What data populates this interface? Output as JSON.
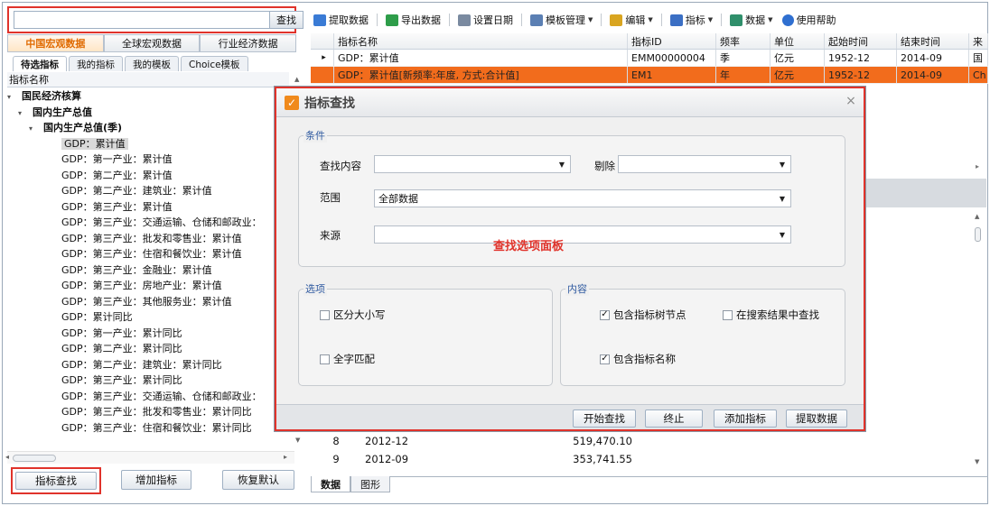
{
  "search": {
    "button": "查找",
    "value": ""
  },
  "category_tabs": [
    "中国宏观数据",
    "全球宏观数据",
    "行业经济数据"
  ],
  "sub_tabs": [
    "待选指标",
    "我的指标",
    "我的模板",
    "Choice模板"
  ],
  "tree": {
    "header": "指标名称",
    "items": [
      {
        "label": "国民经济核算",
        "level": 0,
        "bold": true,
        "toggle": "▾"
      },
      {
        "label": "国内生产总值",
        "level": 1,
        "bold": true,
        "toggle": "▾"
      },
      {
        "label": "国内生产总值(季)",
        "level": 2,
        "bold": true,
        "toggle": "▾"
      },
      {
        "label": "GDP：累计值",
        "level": 3,
        "selected": true
      },
      {
        "label": "GDP：第一产业：累计值",
        "level": 3
      },
      {
        "label": "GDP：第二产业：累计值",
        "level": 3
      },
      {
        "label": "GDP：第二产业：建筑业：累计值",
        "level": 3
      },
      {
        "label": "GDP：第三产业：累计值",
        "level": 3
      },
      {
        "label": "GDP：第三产业：交通运输、仓储和邮政业：",
        "level": 3
      },
      {
        "label": "GDP：第三产业：批发和零售业：累计值",
        "level": 3
      },
      {
        "label": "GDP：第三产业：住宿和餐饮业：累计值",
        "level": 3
      },
      {
        "label": "GDP：第三产业：金融业：累计值",
        "level": 3
      },
      {
        "label": "GDP：第三产业：房地产业：累计值",
        "level": 3
      },
      {
        "label": "GDP：第三产业：其他服务业：累计值",
        "level": 3
      },
      {
        "label": "GDP：累计同比",
        "level": 3
      },
      {
        "label": "GDP：第一产业：累计同比",
        "level": 3
      },
      {
        "label": "GDP：第二产业：累计同比",
        "level": 3
      },
      {
        "label": "GDP：第二产业：建筑业：累计同比",
        "level": 3
      },
      {
        "label": "GDP：第三产业：累计同比",
        "level": 3
      },
      {
        "label": "GDP：第三产业：交通运输、仓储和邮政业：",
        "level": 3
      },
      {
        "label": "GDP：第三产业：批发和零售业：累计同比",
        "level": 3
      },
      {
        "label": "GDP：第三产业：住宿和餐饮业：累计同比",
        "level": 3
      }
    ]
  },
  "left_buttons": [
    "指标查找",
    "增加指标",
    "恢复默认"
  ],
  "toolbar": [
    {
      "label": "提取数据",
      "icon": "extract-data-icon",
      "color": "#3a7bd5",
      "caret": false
    },
    {
      "label": "导出数据",
      "icon": "export-data-icon",
      "color": "#2e9d4a",
      "caret": false
    },
    {
      "label": "设置日期",
      "icon": "calendar-icon",
      "color": "#7a8aa0",
      "caret": false
    },
    {
      "label": "模板管理",
      "icon": "template-icon",
      "color": "#5b7fb3",
      "caret": true
    },
    {
      "label": "编辑",
      "icon": "edit-icon",
      "color": "#d9a520",
      "caret": true
    },
    {
      "label": "指标",
      "icon": "function-icon",
      "color": "#3b6fc4",
      "caret": true
    },
    {
      "label": "数据",
      "icon": "data-icon",
      "color": "#2f8f6b",
      "caret": true
    },
    {
      "label": "使用帮助",
      "icon": "help-icon",
      "color": "#2f6fd0",
      "caret": false
    }
  ],
  "grid": {
    "headers": [
      "",
      "指标名称",
      "指标ID",
      "频率",
      "单位",
      "起始时间",
      "结束时间",
      "来"
    ],
    "rows": [
      {
        "marker": "▸",
        "cells": [
          "GDP：累计值",
          "EMM00000004",
          "季",
          "亿元",
          "1952-12",
          "2014-09",
          "国"
        ],
        "highlight": false
      },
      {
        "marker": "",
        "cells": [
          "GDP：累计值[新频率:年度, 方式:合计值]",
          "EM1",
          "年",
          "亿元",
          "1952-12",
          "2014-09",
          "Ch"
        ],
        "highlight": true
      }
    ]
  },
  "data_rows": [
    {
      "index": "8",
      "date": "2012-12",
      "value": "519,470.10"
    },
    {
      "index": "9",
      "date": "2012-09",
      "value": "353,741.55"
    }
  ],
  "bottom_tabs": [
    "数据",
    "图形"
  ],
  "dialog": {
    "title": "指标查找",
    "conditions_label": "条件",
    "find_label": "查找内容",
    "find_value": "",
    "exclude_label": "剔除",
    "exclude_value": "",
    "scope_label": "范围",
    "scope_value": "全部数据",
    "source_label": "来源",
    "source_value": "",
    "annotation": "查找选项面板",
    "options_label": "选项",
    "opt_case": "区分大小写",
    "opt_whole": "全字匹配",
    "content_label": "内容",
    "inc_tree": "包含指标树节点",
    "in_results": "在搜索结果中查找",
    "inc_name": "包含指标名称",
    "buttons": [
      "开始查找",
      "终止",
      "添加指标",
      "提取数据"
    ],
    "close": "×",
    "logo_mark": "✓"
  },
  "colors": {
    "accent_red": "#e0332b",
    "highlight_orange": "#f26c1c",
    "tab_orange": "#e06a00"
  }
}
